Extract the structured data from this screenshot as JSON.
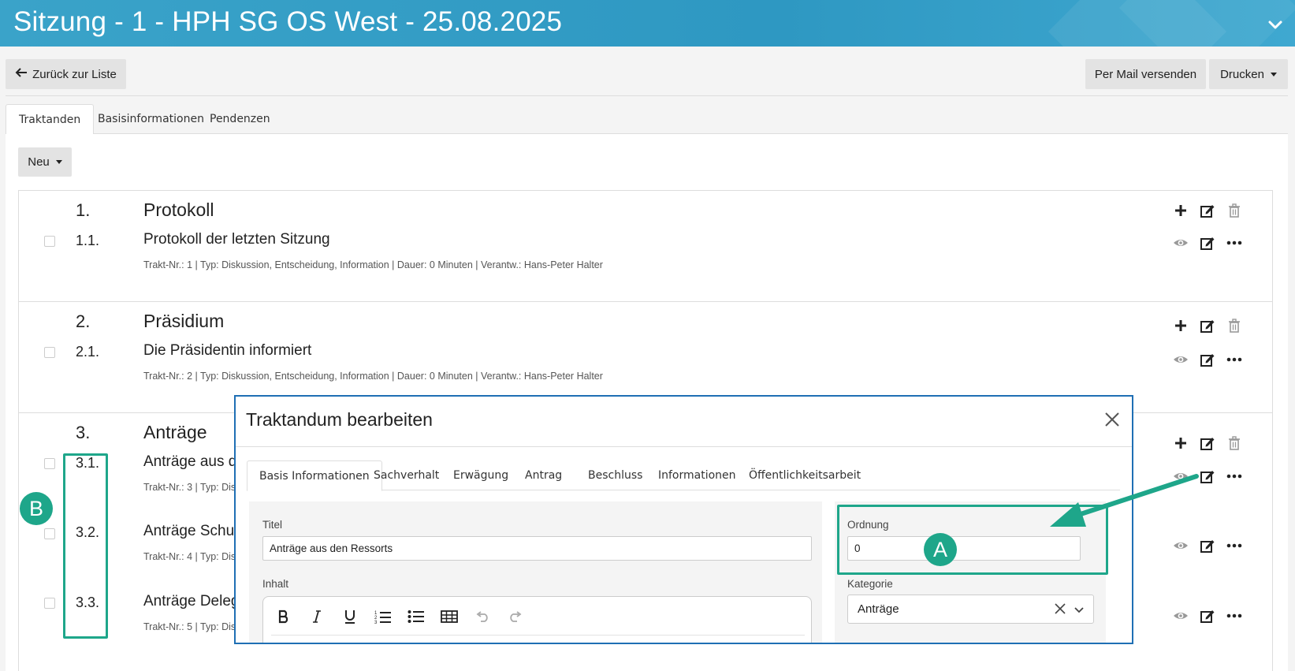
{
  "header": {
    "title": "Sitzung - 1 - HPH SG OS West - 25.08.2025"
  },
  "toolbar": {
    "back_label": "Zurück zur Liste",
    "mail_label": "Per Mail versenden",
    "print_label": "Drucken"
  },
  "tabs": [
    {
      "label": "Traktanden",
      "active": true
    },
    {
      "label": "Basisinformationen",
      "active": false
    },
    {
      "label": "Pendenzen",
      "active": false
    }
  ],
  "new_button": "Neu",
  "sections": [
    {
      "num": "1.",
      "title": "Protokoll",
      "items": [
        {
          "num": "1.1.",
          "title": "Protokoll der letzten Sitzung",
          "meta": "Trakt-Nr.: 1 | Typ: Diskussion, Entscheidung, Information | Dauer: 0 Minuten | Verantw.: Hans-Peter Halter"
        }
      ]
    },
    {
      "num": "2.",
      "title": "Präsidium",
      "items": [
        {
          "num": "2.1.",
          "title": "Die Präsidentin informiert",
          "meta": "Trakt-Nr.: 2 | Typ: Diskussion, Entscheidung, Information | Dauer: 0 Minuten | Verantw.: Hans-Peter Halter"
        }
      ]
    },
    {
      "num": "3.",
      "title": "Anträge",
      "items": [
        {
          "num": "3.1.",
          "title": "Anträge aus d",
          "meta": "Trakt-Nr.: 3 | Typ: Dis"
        },
        {
          "num": "3.2.",
          "title": "Anträge Schul",
          "meta": "Trakt-Nr.: 4 | Typ: Dis"
        },
        {
          "num": "3.3.",
          "title": "Anträge Deleg",
          "meta": "Trakt-Nr.: 5 | Typ: Dis"
        }
      ]
    }
  ],
  "modal": {
    "title": "Traktandum bearbeiten",
    "tabs": [
      "Basis Informationen",
      "Sachverhalt",
      "Erwägung",
      "Antrag",
      "Beschluss",
      "Informationen",
      "Öffentlichkeitsarbeit"
    ],
    "fields": {
      "titel_label": "Titel",
      "titel_value": "Anträge aus den Ressorts",
      "inhalt_label": "Inhalt",
      "ordnung_label": "Ordnung",
      "ordnung_value": "0",
      "kategorie_label": "Kategorie",
      "kategorie_value": "Anträge"
    }
  },
  "annotations": {
    "a": "A",
    "b": "B"
  },
  "colors": {
    "header": "#2e98c2",
    "accent": "#1ea68a",
    "modal_border": "#1f6fb4"
  }
}
